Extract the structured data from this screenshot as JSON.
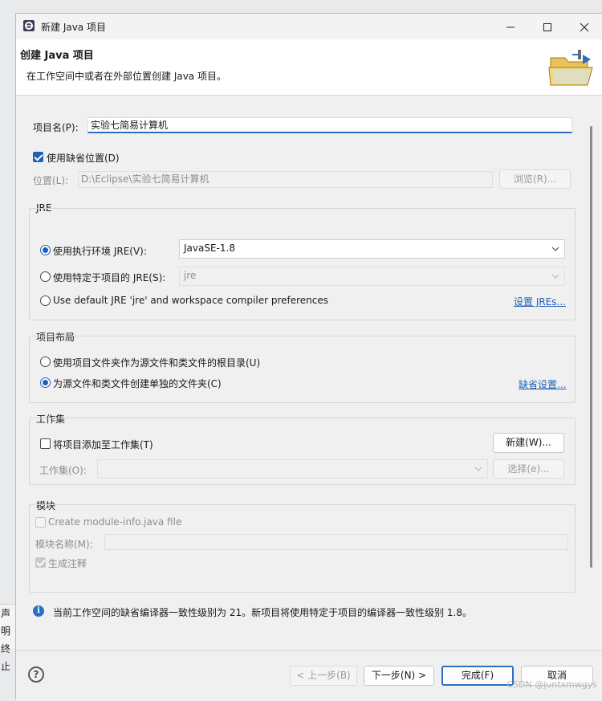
{
  "background": {
    "partial_lines": [
      "声明",
      "终止"
    ]
  },
  "window": {
    "title": "新建 Java 项目"
  },
  "header": {
    "title": "创建 Java 项目",
    "description": "在工作空间中或者在外部位置创建 Java 项目。"
  },
  "project": {
    "name_label": "项目名(P):",
    "name_value": "实验七简易计算机"
  },
  "location": {
    "use_default_label": "使用缺省位置(D)",
    "use_default_checked": true,
    "location_label": "位置(L):",
    "location_value": "D:\\Eclipse\\实验七简易计算机",
    "browse_label": "浏览(R)..."
  },
  "jre": {
    "group_title": "JRE",
    "opt_exec_env_label": "使用执行环境 JRE(V):",
    "exec_env_value": "JavaSE-1.8",
    "opt_project_jre_label": "使用特定于项目的 JRE(S):",
    "project_jre_value": "jre",
    "opt_default_label": "Use default JRE 'jre' and workspace compiler preferences",
    "configure_link": "设置 JREs..."
  },
  "layout": {
    "group_title": "项目布局",
    "opt_project_folder_label": "使用项目文件夹作为源文件和类文件的根目录(U)",
    "opt_separate_label": "为源文件和类文件创建单独的文件夹(C)",
    "configure_link": "缺省设置..."
  },
  "working_sets": {
    "group_title": "工作集",
    "add_label": "将项目添加至工作集(T)",
    "new_button": "新建(W)...",
    "sets_label": "工作集(O):",
    "select_button": "选择(e)..."
  },
  "module": {
    "group_title": "模块",
    "create_label": "Create module-info.java file",
    "name_label": "模块名称(M):",
    "generate_comments_label": "生成注释"
  },
  "message": {
    "text": "当前工作空间的缺省编译器一致性级别为 21。新项目将使用特定于项目的编译器一致性级别 1.8。"
  },
  "footer": {
    "help": "?",
    "back_button": "< 上一步(B)",
    "next_button": "下一步(N) >",
    "finish_button": "完成(F)",
    "cancel_button": "取消",
    "watermark": "CSDN @juntxmwgys"
  },
  "colors": {
    "accent": "#1f5fb8",
    "link": "#1f5fb8",
    "focus_underline": "#2b6fc2"
  },
  "icons": [
    "eclipse-app-icon",
    "minimize-icon",
    "maximize-icon",
    "close-icon",
    "java-folder-wizard-icon",
    "info-icon",
    "help-icon",
    "chevron-down-icon"
  ]
}
